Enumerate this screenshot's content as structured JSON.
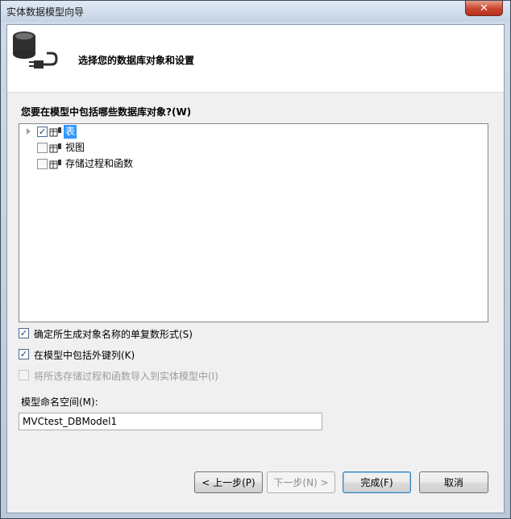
{
  "window": {
    "title": "实体数据模型向导",
    "close_glyph": "✕"
  },
  "header": {
    "title": "选择您的数据库对象和设置",
    "icon": "database-plug-icon"
  },
  "objects_section": {
    "label": "您要在模型中包括哪些数据库对象?(W)"
  },
  "tree": {
    "items": [
      {
        "label": "表",
        "checked": true,
        "selected": true,
        "expandable": true
      },
      {
        "label": "视图",
        "checked": false,
        "selected": false,
        "expandable": false
      },
      {
        "label": "存储过程和函数",
        "checked": false,
        "selected": false,
        "expandable": false
      }
    ]
  },
  "options": [
    {
      "label": "确定所生成对象名称的单复数形式(S)",
      "checked": true,
      "enabled": true
    },
    {
      "label": "在模型中包括外键列(K)",
      "checked": true,
      "enabled": true
    },
    {
      "label": "将所选存储过程和函数导入到实体模型中(I)",
      "checked": false,
      "enabled": false
    }
  ],
  "namespace": {
    "label": "模型命名空间(M):",
    "value": "MVCtest_DBModel1"
  },
  "buttons": {
    "previous": "< 上一步(P)",
    "next": "下一步(N) >",
    "finish": "完成(F)",
    "cancel": "取消"
  },
  "check_glyph": "✓"
}
